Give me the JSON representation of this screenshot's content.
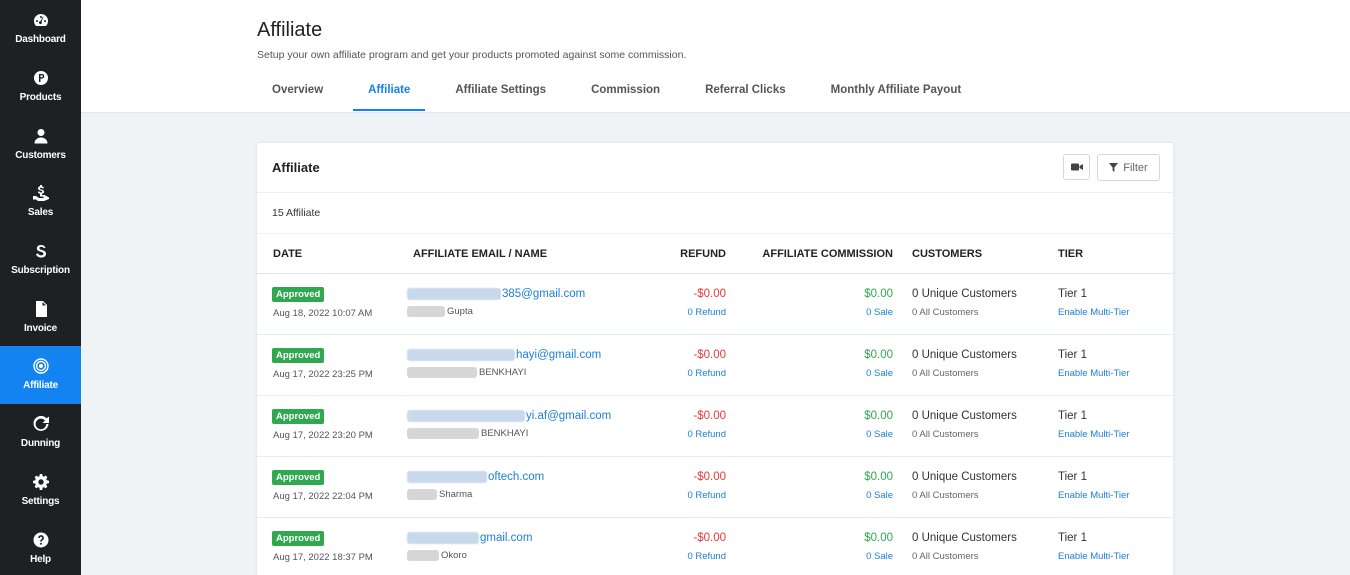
{
  "sidebar": {
    "items": [
      {
        "label": "Dashboard",
        "icon": "gauge-icon"
      },
      {
        "label": "Products",
        "icon": "product-icon"
      },
      {
        "label": "Customers",
        "icon": "user-icon"
      },
      {
        "label": "Sales",
        "icon": "sales-icon"
      },
      {
        "label": "Subscription",
        "icon": "subscription-icon"
      },
      {
        "label": "Invoice",
        "icon": "invoice-icon"
      },
      {
        "label": "Affiliate",
        "icon": "affiliate-icon"
      },
      {
        "label": "Dunning",
        "icon": "refresh-icon"
      },
      {
        "label": "Settings",
        "icon": "gear-icon"
      },
      {
        "label": "Help",
        "icon": "help-icon"
      }
    ],
    "active": "Affiliate"
  },
  "header": {
    "title": "Affiliate",
    "subtitle": "Setup your own affiliate program and get your products promoted against some commission.",
    "tabs": [
      "Overview",
      "Affiliate",
      "Affiliate Settings",
      "Commission",
      "Referral Clicks",
      "Monthly Affiliate Payout"
    ],
    "active_tab": "Affiliate"
  },
  "card": {
    "title": "Affiliate",
    "filter_label": "Filter",
    "count_text": "15 Affiliate",
    "columns": {
      "date": "DATE",
      "email": "AFFILIATE EMAIL / NAME",
      "refund": "REFUND",
      "commission": "AFFILIATE COMMISSION",
      "customers": "CUSTOMERS",
      "tier": "TIER"
    },
    "rows": [
      {
        "status": "Approved",
        "date": "Aug 18, 2022 10:07 AM",
        "email": "385@gmail.com",
        "name": "Gupta",
        "refund": "-$0.00",
        "refund_link": "0 Refund",
        "commission": "$0.00",
        "sale_link": "0 Sale",
        "customers": "0 Unique Customers",
        "customers_sub": "0 All Customers",
        "tier": "Tier 1",
        "tier_link": "Enable Multi-Tier"
      },
      {
        "status": "Approved",
        "date": "Aug 17, 2022 23:25 PM",
        "email": "hayi@gmail.com",
        "name": "BENKHAYI",
        "refund": "-$0.00",
        "refund_link": "0 Refund",
        "commission": "$0.00",
        "sale_link": "0 Sale",
        "customers": "0 Unique Customers",
        "customers_sub": "0 All Customers",
        "tier": "Tier 1",
        "tier_link": "Enable Multi-Tier"
      },
      {
        "status": "Approved",
        "date": "Aug 17, 2022 23:20 PM",
        "email": "yi.af@gmail.com",
        "name": "BENKHAYI",
        "refund": "-$0.00",
        "refund_link": "0 Refund",
        "commission": "$0.00",
        "sale_link": "0 Sale",
        "customers": "0 Unique Customers",
        "customers_sub": "0 All Customers",
        "tier": "Tier 1",
        "tier_link": "Enable Multi-Tier"
      },
      {
        "status": "Approved",
        "date": "Aug 17, 2022 22:04 PM",
        "email": "oftech.com",
        "name": "Sharma",
        "refund": "-$0.00",
        "refund_link": "0 Refund",
        "commission": "$0.00",
        "sale_link": "0 Sale",
        "customers": "0 Unique Customers",
        "customers_sub": "0 All Customers",
        "tier": "Tier 1",
        "tier_link": "Enable Multi-Tier"
      },
      {
        "status": "Approved",
        "date": "Aug 17, 2022 18:37 PM",
        "email": "gmail.com",
        "name": "Okoro",
        "refund": "-$0.00",
        "refund_link": "0 Refund",
        "commission": "$0.00",
        "sale_link": "0 Sale",
        "customers": "0 Unique Customers",
        "customers_sub": "0 All Customers",
        "tier": "Tier 1",
        "tier_link": "Enable Multi-Tier"
      }
    ]
  },
  "colors": {
    "sidebar_bg": "#1e2124",
    "accent": "#1283f0",
    "approved": "#2fa84f",
    "refund": "#e23a3a",
    "link": "#1a7fd6"
  }
}
